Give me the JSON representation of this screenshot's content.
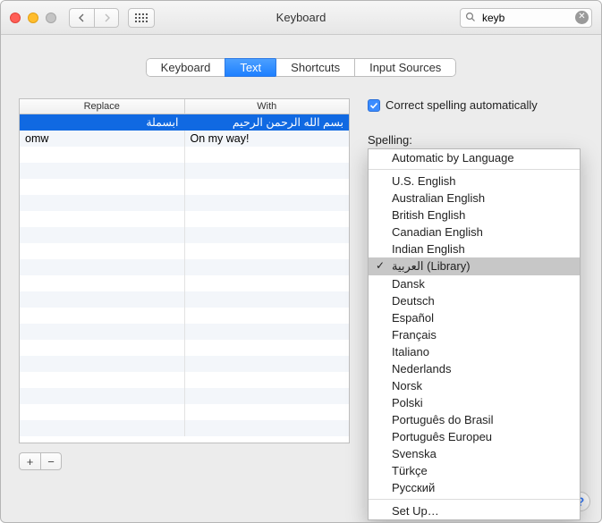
{
  "window": {
    "title": "Keyboard"
  },
  "toolbar": {
    "search_value": "keyb"
  },
  "tabs": [
    {
      "label": "Keyboard"
    },
    {
      "label": "Text"
    },
    {
      "label": "Shortcuts"
    },
    {
      "label": "Input Sources"
    }
  ],
  "table": {
    "col_replace": "Replace",
    "col_with": "With",
    "rows": [
      {
        "replace": "ابسملة",
        "with": "بسم الله الرحمن الرحيم",
        "rtl": true,
        "selected": true
      },
      {
        "replace": "omw",
        "with": "On my way!"
      }
    ]
  },
  "buttons": {
    "add": "+",
    "remove": "−"
  },
  "right": {
    "correct_label": "Correct spelling automatically",
    "spelling_label": "Spelling:"
  },
  "dropdown": {
    "auto": "Automatic by Language",
    "langs": [
      "U.S. English",
      "Australian English",
      "British English",
      "Canadian English",
      "Indian English",
      "العربية (Library)",
      "Dansk",
      "Deutsch",
      "Español",
      "Français",
      "Italiano",
      "Nederlands",
      "Norsk",
      "Polski",
      "Português do Brasil",
      "Português Europeu",
      "Svenska",
      "Türkçe",
      "Русский"
    ],
    "selected_index": 5,
    "setup": "Set Up…"
  },
  "help": "?"
}
